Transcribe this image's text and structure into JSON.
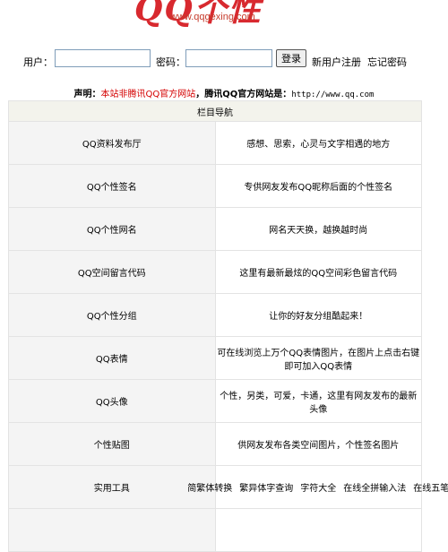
{
  "logo": {
    "title": "QQ个性",
    "url": "www.qqgexing.com"
  },
  "login": {
    "username_label": "用户：",
    "password_label": "密码：",
    "username_value": "",
    "password_value": "",
    "login_button": "登录",
    "register_link": "新用户注册",
    "forgot_link": "忘记密码"
  },
  "notice": {
    "prefix": "声明：",
    "red": "本站非腾讯QQ官方网站",
    "middle": "，腾讯QQ官方网站是：",
    "url": "http://www.qq.com"
  },
  "nav": {
    "header": "栏目导航",
    "rows": [
      {
        "category": "QQ资料发布厅",
        "description": "感想、思索，心灵与文字相遇的地方"
      },
      {
        "category": "QQ个性签名",
        "description": "专供网友发布QQ昵称后面的个性签名"
      },
      {
        "category": "QQ个性网名",
        "description": "网名天天换，越换越时尚"
      },
      {
        "category": "QQ空间留言代码",
        "description": "这里有最新最炫的QQ空间彩色留言代码"
      },
      {
        "category": "QQ个性分组",
        "description": "让你的好友分组酷起来！"
      },
      {
        "category": "QQ表情",
        "description": "可在线浏览上万个QQ表情图片，在图片上点击右键即可加入QQ表情"
      },
      {
        "category": "QQ头像",
        "description": "个性，另类，可爱，卡通，这里有网友发布的最新头像"
      },
      {
        "category": "个性贴图",
        "description": "供网友发布各类空间图片，个性签名图片"
      }
    ],
    "tools_category": "实用工具",
    "tools": [
      "简繁体转换",
      "繁异体字查询",
      "字符大全",
      "在线全拼输入法",
      "在线五笔"
    ]
  }
}
